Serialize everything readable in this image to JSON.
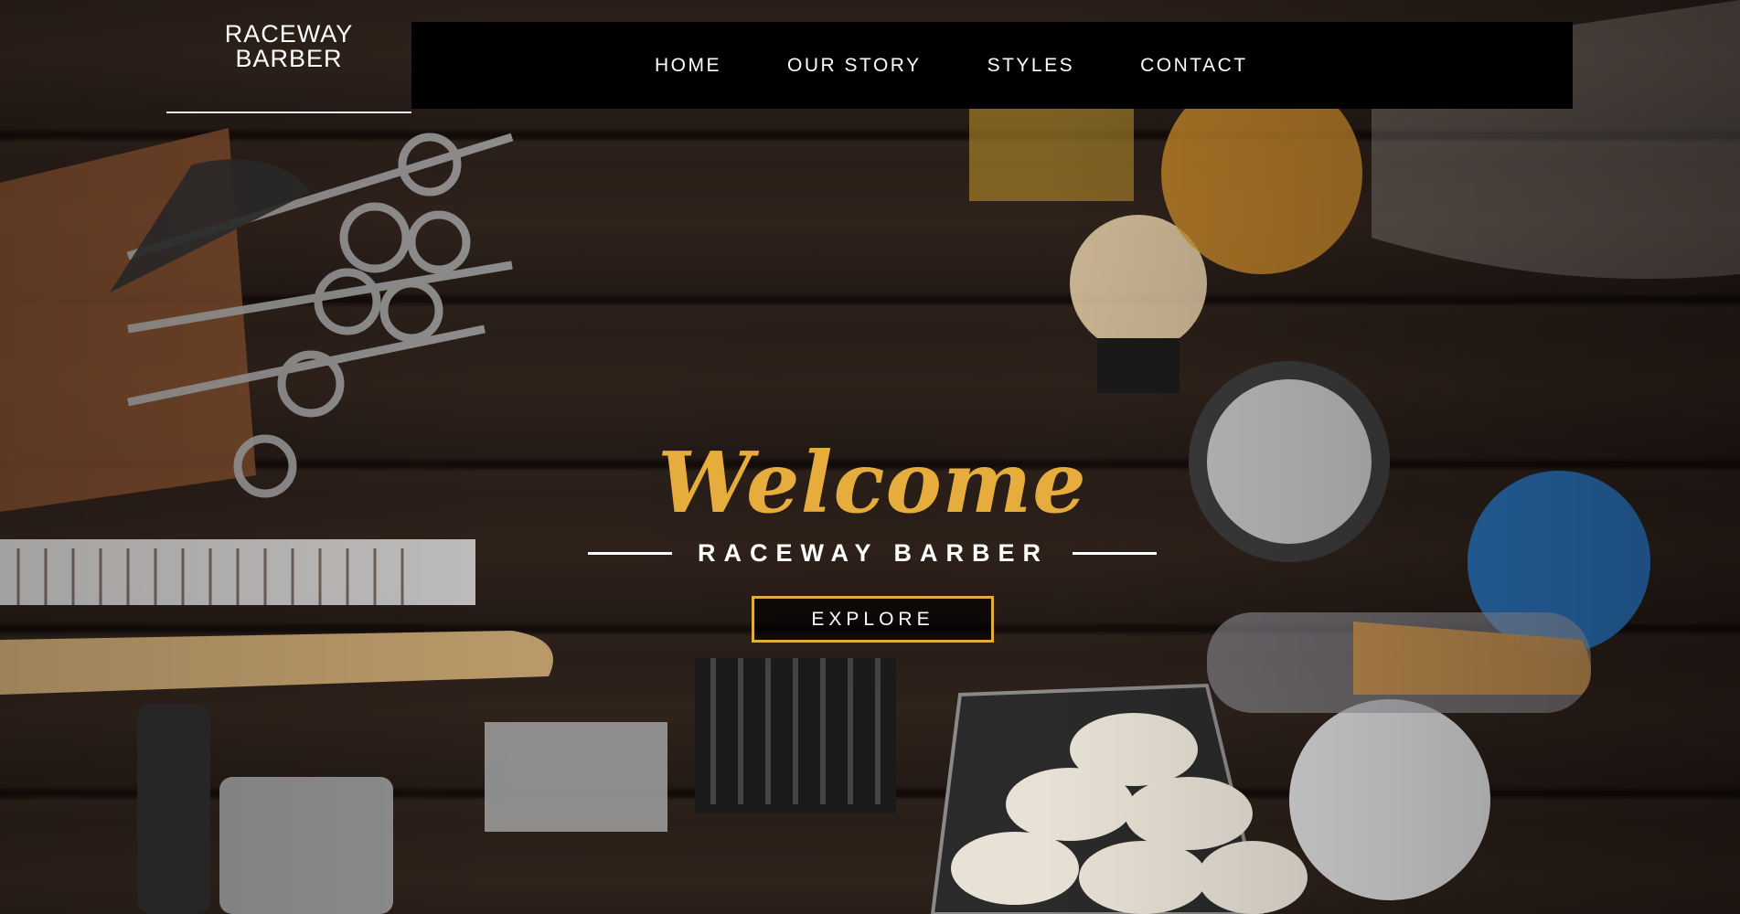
{
  "brand": {
    "line1": "RACEWAY",
    "line2": "BARBER"
  },
  "nav": {
    "items": [
      {
        "label": "HOME"
      },
      {
        "label": "OUR STORY"
      },
      {
        "label": "STYLES"
      },
      {
        "label": "CONTACT"
      }
    ]
  },
  "hero": {
    "title": "Welcome",
    "subtitle": "RACEWAY BARBER",
    "button_label": "EXPLORE"
  },
  "colors": {
    "accent_gold": "#e6ad3d",
    "nav_background": "#000000",
    "text": "#ffffff"
  }
}
